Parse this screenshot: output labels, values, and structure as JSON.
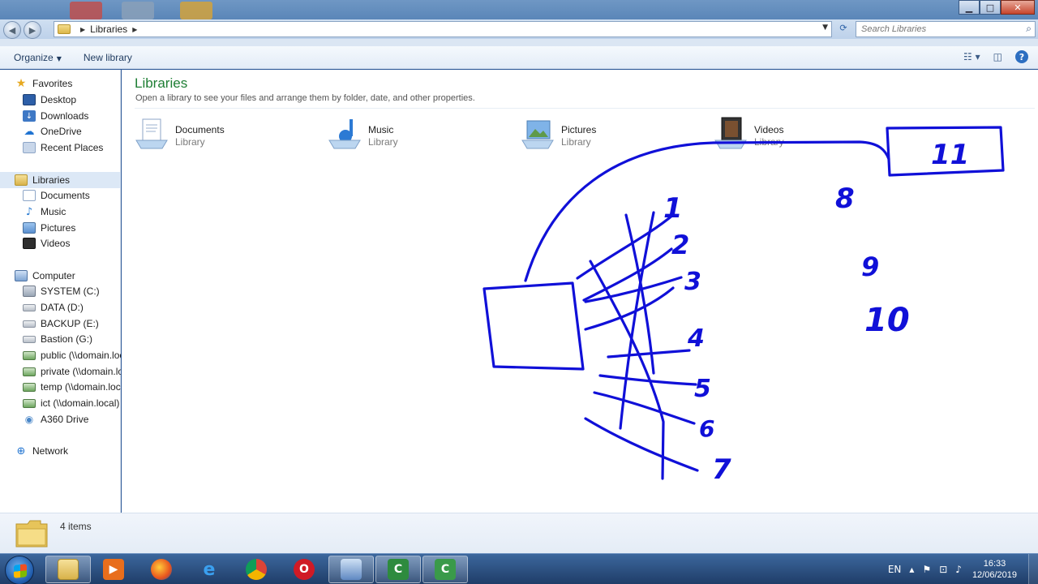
{
  "window": {
    "address": {
      "crumb": "Libraries"
    },
    "search": {
      "placeholder": "Search Libraries"
    },
    "controls": {
      "minimize": "▁",
      "maximize": "□",
      "close": "✕"
    }
  },
  "toolbar": {
    "organize_label": "Organize",
    "new_library_label": "New library"
  },
  "sidebar": {
    "favorites": {
      "label": "Favorites",
      "items": [
        {
          "label": "Desktop",
          "icon": "desktop-icon"
        },
        {
          "label": "Downloads",
          "icon": "downloads-icon"
        },
        {
          "label": "OneDrive",
          "icon": "onedrive-icon"
        },
        {
          "label": "Recent Places",
          "icon": "recent-places-icon"
        }
      ]
    },
    "libraries": {
      "label": "Libraries",
      "items": [
        {
          "label": "Documents",
          "icon": "documents-icon"
        },
        {
          "label": "Music",
          "icon": "music-icon"
        },
        {
          "label": "Pictures",
          "icon": "pictures-icon"
        },
        {
          "label": "Videos",
          "icon": "videos-icon"
        }
      ]
    },
    "computer": {
      "label": "Computer",
      "items": [
        {
          "label": "SYSTEM (C:)",
          "icon": "drive-icon"
        },
        {
          "label": "DATA (D:)",
          "icon": "drive-icon"
        },
        {
          "label": "BACKUP (E:)",
          "icon": "drive-icon"
        },
        {
          "label": "Bastion (G:)",
          "icon": "drive-icon"
        },
        {
          "label": "public (\\\\domain.loc",
          "icon": "network-drive-icon"
        },
        {
          "label": "private (\\\\domain.lo",
          "icon": "network-drive-icon"
        },
        {
          "label": "temp (\\\\domain.loc",
          "icon": "network-drive-icon"
        },
        {
          "label": "ict (\\\\domain.local)",
          "icon": "network-drive-icon"
        },
        {
          "label": "A360 Drive",
          "icon": "a360-drive-icon"
        }
      ]
    },
    "network": {
      "label": "Network"
    }
  },
  "content": {
    "title": "Libraries",
    "description": "Open a library to see your files and arrange them by folder, date, and other properties.",
    "libraries": [
      {
        "name": "Documents",
        "type": "Library",
        "icon": "documents-library-icon"
      },
      {
        "name": "Music",
        "type": "Library",
        "icon": "music-library-icon"
      },
      {
        "name": "Pictures",
        "type": "Library",
        "icon": "pictures-library-icon"
      },
      {
        "name": "Videos",
        "type": "Library",
        "icon": "videos-library-icon"
      }
    ]
  },
  "annotations": {
    "color": "#1010d8",
    "numbers": [
      "1",
      "2",
      "3",
      "4",
      "5",
      "6",
      "7",
      "8",
      "9",
      "10",
      "11"
    ]
  },
  "details": {
    "items_count": "4 items"
  },
  "taskbar": {
    "language": "EN",
    "time": "16:33",
    "date": "12/06/2019",
    "apps": [
      "windows-explorer",
      "media-player",
      "firefox",
      "internet-explorer",
      "chrome",
      "opera",
      "remote-desktop",
      "camtasia-recorder",
      "camtasia-studio"
    ]
  },
  "colors": {
    "accent_green": "#1e7e34",
    "taskbar": "#2a4f80",
    "selection": "#dce8f6"
  }
}
